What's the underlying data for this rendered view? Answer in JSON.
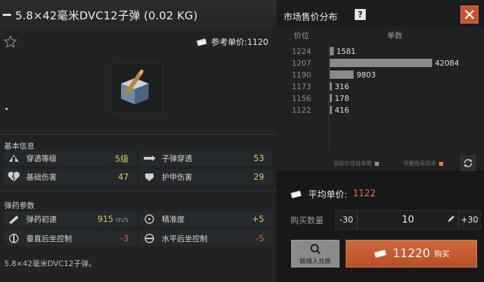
{
  "item": {
    "title": "5.8×42毫米DVC12子弹 (0.02 KG)",
    "reference_price_label": "参考单价:1120",
    "description": "5.8×42毫米DVC12子弹。"
  },
  "basic_info": {
    "label": "基本信息",
    "stats": [
      {
        "label": "穿透等级",
        "value": "5级",
        "icon": "penetration-icon"
      },
      {
        "label": "子弹穿透",
        "value": "53",
        "icon": "bullet-penetration-icon"
      },
      {
        "label": "基础伤害",
        "value": "47",
        "icon": "broken-heart-icon"
      },
      {
        "label": "护甲伤害",
        "value": "29",
        "icon": "armor-damage-icon"
      }
    ]
  },
  "ammo_params": {
    "label": "弹药参数",
    "stats": [
      {
        "label": "弹药初速",
        "value": "915",
        "unit": "m/s",
        "icon": "velocity-icon"
      },
      {
        "label": "精准度",
        "value": "+5",
        "icon": "crosshair-icon"
      },
      {
        "label": "垂直后坐控制",
        "value": "-3",
        "icon": "vertical-recoil-icon"
      },
      {
        "label": "水平后坐控制",
        "value": "-5",
        "icon": "horizontal-recoil-icon"
      }
    ]
  },
  "market": {
    "title": "市场售价分布",
    "help": "?",
    "col_price": "价位",
    "col_qty": "单数",
    "legend_sell": "当前价位挂单数",
    "legend_buy": "将要购买的单",
    "colors": {
      "bar": "#8a8a8a",
      "buy_marker": "#e8703a"
    }
  },
  "chart_data": {
    "type": "bar",
    "orientation": "horizontal",
    "categories": [
      "1224",
      "1207",
      "1190",
      "1173",
      "1156",
      "1122"
    ],
    "values": [
      1581,
      42084,
      9803,
      316,
      178,
      416
    ],
    "data_labels": [
      "1581",
      "42084",
      "9803",
      "316",
      "178",
      "416"
    ],
    "xlabel": "单数",
    "ylabel": "价位"
  },
  "purchase": {
    "avg_label": "平均单价:",
    "avg_value": "1122",
    "qty_label": "购买数量",
    "minus": "-30",
    "qty": "10",
    "plus": "+30",
    "contact_label": "联络人兑换",
    "buy_amount": "11220",
    "buy_label": "购买"
  }
}
